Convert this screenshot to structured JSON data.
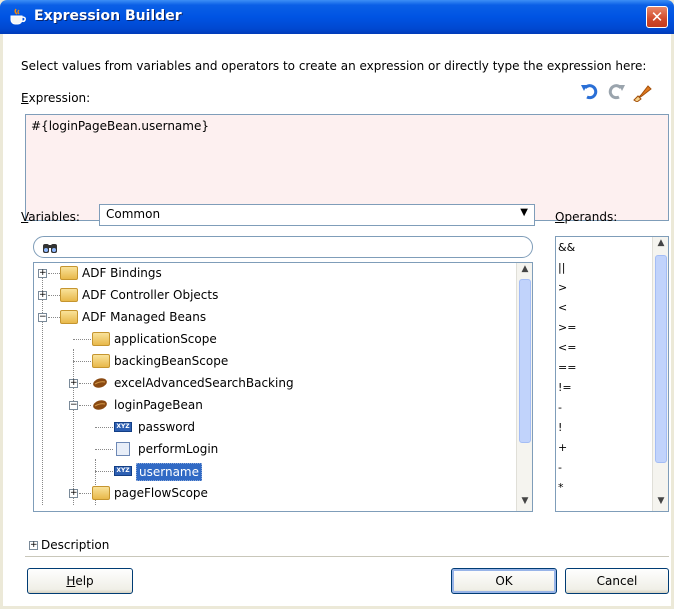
{
  "window": {
    "title": "Expression Builder",
    "close_glyph": "✕",
    "icon": "java-cup-icon"
  },
  "instruction": "Select values from variables and operators to create an expression or directly type the expression here:",
  "expression": {
    "label": "Expression:",
    "value": "#{loginPageBean.username}",
    "toolbar": [
      "undo-icon",
      "redo-icon",
      "clear-icon"
    ]
  },
  "variables": {
    "label": "Variables:",
    "selected": "Common",
    "tree": [
      {
        "label": "ADF Bindings",
        "icon": "folder-icon",
        "expander": "+"
      },
      {
        "label": "ADF Controller Objects",
        "icon": "folder-icon",
        "expander": "+"
      },
      {
        "label": "ADF Managed Beans",
        "icon": "folder-icon",
        "expander": "−"
      },
      {
        "label": "applicationScope",
        "icon": "folder-icon",
        "expander": ""
      },
      {
        "label": "backingBeanScope",
        "icon": "folder-icon",
        "expander": ""
      },
      {
        "label": "excelAdvancedSearchBacking",
        "icon": "bean-icon",
        "expander": "+"
      },
      {
        "label": "loginPageBean",
        "icon": "bean-icon",
        "expander": "−"
      },
      {
        "label": "password",
        "icon": "property-icon",
        "expander": ""
      },
      {
        "label": "performLogin",
        "icon": "method-icon",
        "expander": ""
      },
      {
        "label": "username",
        "icon": "property-icon",
        "expander": "",
        "selected": true
      },
      {
        "label": "pageFlowScope",
        "icon": "folder-icon",
        "expander": "+"
      }
    ]
  },
  "operands": {
    "label": "Operands:",
    "items": [
      "&&",
      "||",
      ">",
      "<",
      ">=",
      "<=",
      "==",
      "!=",
      "-",
      "!",
      "+",
      "-",
      "*"
    ]
  },
  "description": {
    "label": "Description",
    "expander": "+"
  },
  "buttons": {
    "help_mnemonic": "H",
    "help_rest": "elp",
    "ok": "OK",
    "cancel": "Cancel"
  }
}
